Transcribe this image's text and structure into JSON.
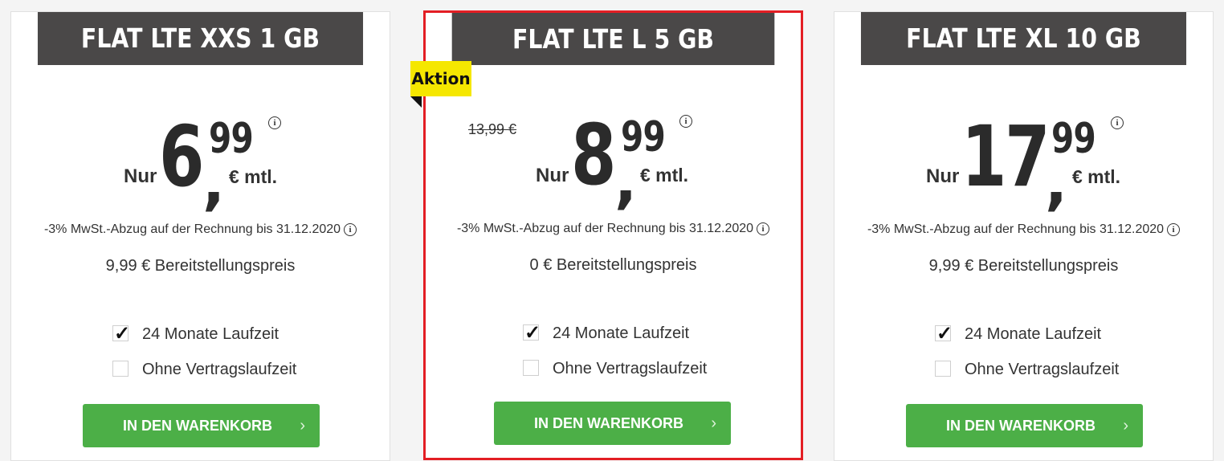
{
  "plans": [
    {
      "title": "FLAT LTE XXS 1 GB",
      "nur": "Nur",
      "price_main": "6",
      "price_comma": ",",
      "price_cents": "99",
      "unit": "€ mtl.",
      "info": "i",
      "vat_note": "-3% MwSt.-Abzug auf der Rechnung bis 31.12.2020",
      "setup": "9,99 € Bereitstellungspreis",
      "options": [
        {
          "label": "24 Monate Laufzeit",
          "checked": true
        },
        {
          "label": "Ohne Vertragslaufzeit",
          "checked": false
        }
      ],
      "button": "IN DEN WARENKORB",
      "arrow": "›"
    },
    {
      "title": "FLAT LTE L 5 GB",
      "badge": "Aktion",
      "old_price": "13,99 €",
      "nur": "Nur",
      "price_main": "8",
      "price_comma": ",",
      "price_cents": "99",
      "unit": "€ mtl.",
      "info": "i",
      "vat_note": "-3% MwSt.-Abzug auf der Rechnung bis 31.12.2020",
      "setup": "0 € Bereitstellungspreis",
      "options": [
        {
          "label": "24 Monate Laufzeit",
          "checked": true
        },
        {
          "label": "Ohne Vertragslaufzeit",
          "checked": false
        }
      ],
      "button": "IN DEN WARENKORB",
      "arrow": "›"
    },
    {
      "title": "FLAT LTE XL 10 GB",
      "nur": "Nur",
      "price_main": "17",
      "price_comma": ",",
      "price_cents": "99",
      "unit": "€ mtl.",
      "info": "i",
      "vat_note": "-3% MwSt.-Abzug auf der Rechnung bis 31.12.2020",
      "setup": "9,99 € Bereitstellungspreis",
      "options": [
        {
          "label": "24 Monate Laufzeit",
          "checked": true
        },
        {
          "label": "Ohne Vertragslaufzeit",
          "checked": false
        }
      ],
      "button": "IN DEN WARENKORB",
      "arrow": "›"
    }
  ],
  "checkmark": "✓",
  "colors": {
    "header_bg": "#4a4848",
    "highlight_border": "#e31e24",
    "badge_bg": "#f5e700",
    "button_bg": "#4caf47"
  }
}
